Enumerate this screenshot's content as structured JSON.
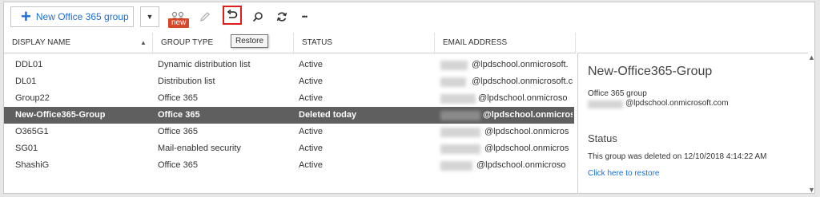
{
  "toolbar": {
    "new_group_label": "New Office 365 group",
    "new_badge": "new",
    "restore_tooltip": "Restore",
    "more_label": "•••",
    "icons": [
      "plus-icon",
      "chevron-down-icon",
      "people-new-icon",
      "pencil-icon",
      "restore-icon",
      "search-icon",
      "refresh-icon",
      "more-icon"
    ]
  },
  "table": {
    "columns": [
      "DISPLAY NAME",
      "GROUP TYPE",
      "STATUS",
      "EMAIL ADDRESS"
    ],
    "rows": [
      {
        "name": "DDL01",
        "type": "Dynamic distribution list",
        "status": "Active",
        "email": "@lpdschool.onmicrosoft."
      },
      {
        "name": "DL01",
        "type": "Distribution list",
        "status": "Active",
        "email": "@lpdschool.onmicrosoft.c..."
      },
      {
        "name": "Group22",
        "type": "Office 365",
        "status": "Active",
        "email": "@lpdschool.onmicroso"
      },
      {
        "name": "New-Office365-Group",
        "type": "Office 365",
        "status": "Deleted today",
        "email": "@lpdschool.onmicros",
        "selected": true
      },
      {
        "name": "O365G1",
        "type": "Office 365",
        "status": "Active",
        "email": "@lpdschool.onmicros"
      },
      {
        "name": "SG01",
        "type": "Mail-enabled security",
        "status": "Active",
        "email": "@lpdschool.onmicros"
      },
      {
        "name": "ShashiG",
        "type": "Office 365",
        "status": "Active",
        "email": "@lpdschool.onmicroso"
      }
    ]
  },
  "detail": {
    "title": "New-Office365-Group",
    "type": "Office 365 group",
    "email": "@lpdschool.onmicrosoft.com",
    "status_heading": "Status",
    "status_text": "This group was deleted on 12/10/2018 4:14:22 AM",
    "restore_link": "Click here to restore"
  },
  "colors": {
    "accent": "#1a6fd8",
    "selected_row": "#5f5f5f",
    "badge": "#d9472b",
    "highlight_box": "#e01c1c"
  }
}
